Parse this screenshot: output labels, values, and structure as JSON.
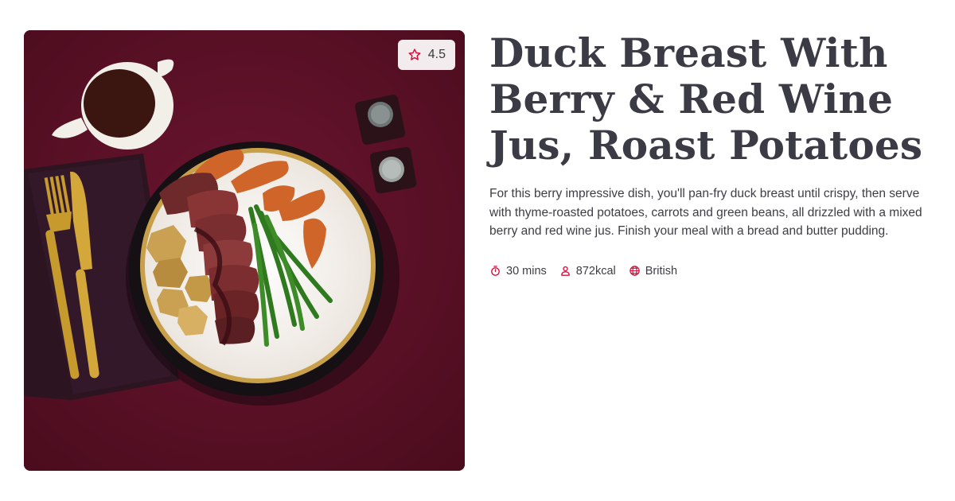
{
  "recipe": {
    "title": "Duck Breast With Berry & Red Wine Jus, Roast Potatoes",
    "description": "For this berry impressive dish, you'll pan-fry duck breast until crispy, then serve with thyme-roasted potatoes, carrots and green beans, all drizzled with a mixed berry and red wine jus. Finish your meal with a bread and butter pudding.",
    "rating": "4.5",
    "rating_icon": "star-icon",
    "meta": {
      "time": "30 mins",
      "time_icon": "timer-icon",
      "calories": "872kcal",
      "calories_icon": "person-icon",
      "cuisine": "British",
      "cuisine_icon": "globe-icon"
    }
  },
  "colors": {
    "accent": "#d6133f",
    "title": "#3a3b45",
    "text": "#3d3d44",
    "photo_background": "#5a1024",
    "badge_background": "#f3ecee"
  }
}
